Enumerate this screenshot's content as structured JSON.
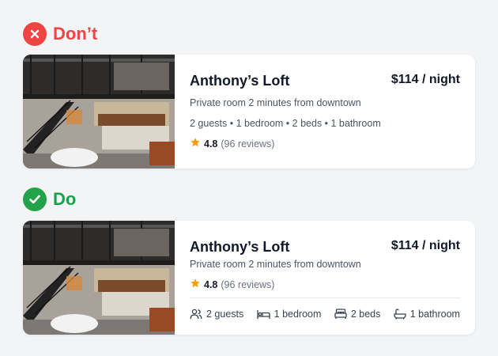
{
  "dont": {
    "label": "Don’t",
    "icon": "x-circle-icon",
    "color": "#ef4444",
    "listing": {
      "title": "Anthony’s Loft",
      "price": "$114 / night",
      "subtitle": "Private room 2 minutes from downtown",
      "details": "2 guests • 1 bedroom • 2 beds • 1 bathroom",
      "rating": "4.8",
      "reviews": "(96 reviews)"
    }
  },
  "do": {
    "label": "Do",
    "icon": "check-circle-icon",
    "color": "#16a34a",
    "listing": {
      "title": "Anthony’s Loft",
      "price": "$114 / night",
      "subtitle": "Private room 2 minutes from downtown",
      "rating": "4.8",
      "reviews": "(96 reviews)",
      "amenities": [
        {
          "icon": "guests-icon",
          "label": "2 guests"
        },
        {
          "icon": "bedroom-icon",
          "label": "1 bedroom"
        },
        {
          "icon": "bed-icon",
          "label": "2 beds"
        },
        {
          "icon": "bathtub-icon",
          "label": "1 bathroom"
        }
      ]
    }
  },
  "colors": {
    "star": "#f59e0b",
    "background": "#f3f4f6"
  }
}
